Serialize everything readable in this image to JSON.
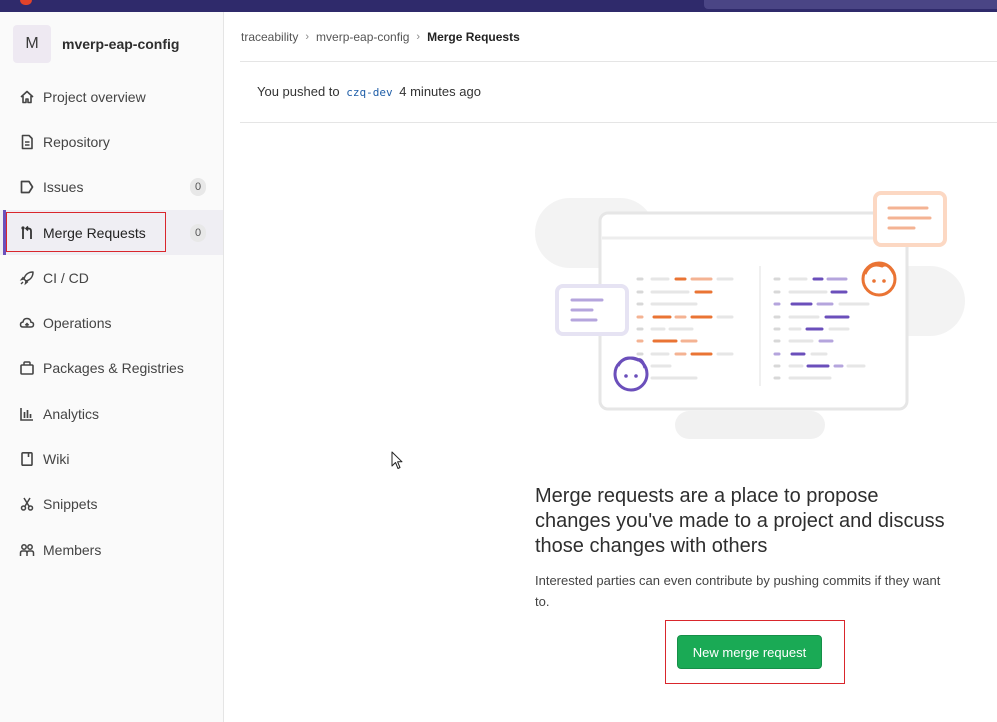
{
  "project": {
    "avatar_letter": "M",
    "name": "mverp-eap-config"
  },
  "sidebar": {
    "items": [
      {
        "label": "Project overview",
        "icon": "home-icon"
      },
      {
        "label": "Repository",
        "icon": "doc-icon"
      },
      {
        "label": "Issues",
        "icon": "issues-icon",
        "count": "0"
      },
      {
        "label": "Merge Requests",
        "icon": "merge-request-icon",
        "count": "0",
        "active": true
      },
      {
        "label": "CI / CD",
        "icon": "rocket-icon"
      },
      {
        "label": "Operations",
        "icon": "cloud-icon"
      },
      {
        "label": "Packages & Registries",
        "icon": "package-icon"
      },
      {
        "label": "Analytics",
        "icon": "chart-icon"
      },
      {
        "label": "Wiki",
        "icon": "book-icon"
      },
      {
        "label": "Snippets",
        "icon": "scissors-icon"
      },
      {
        "label": "Members",
        "icon": "users-icon"
      }
    ]
  },
  "breadcrumb": {
    "items": [
      "traceability",
      "mverp-eap-config"
    ],
    "current": "Merge Requests"
  },
  "push_notice": {
    "prefix": "You pushed to",
    "branch": "czq-dev",
    "suffix": "4 minutes ago"
  },
  "empty_state": {
    "title": "Merge requests are a place to propose changes you've made to a project and discuss those changes with others",
    "description": "Interested parties can even contribute by pushing commits if they want to.",
    "button_label": "New merge request"
  },
  "colors": {
    "topbar": "#2f2a6b",
    "active_accent": "#6b4fbb",
    "primary_button": "#1aaa55",
    "highlight_box": "#d9262c"
  }
}
